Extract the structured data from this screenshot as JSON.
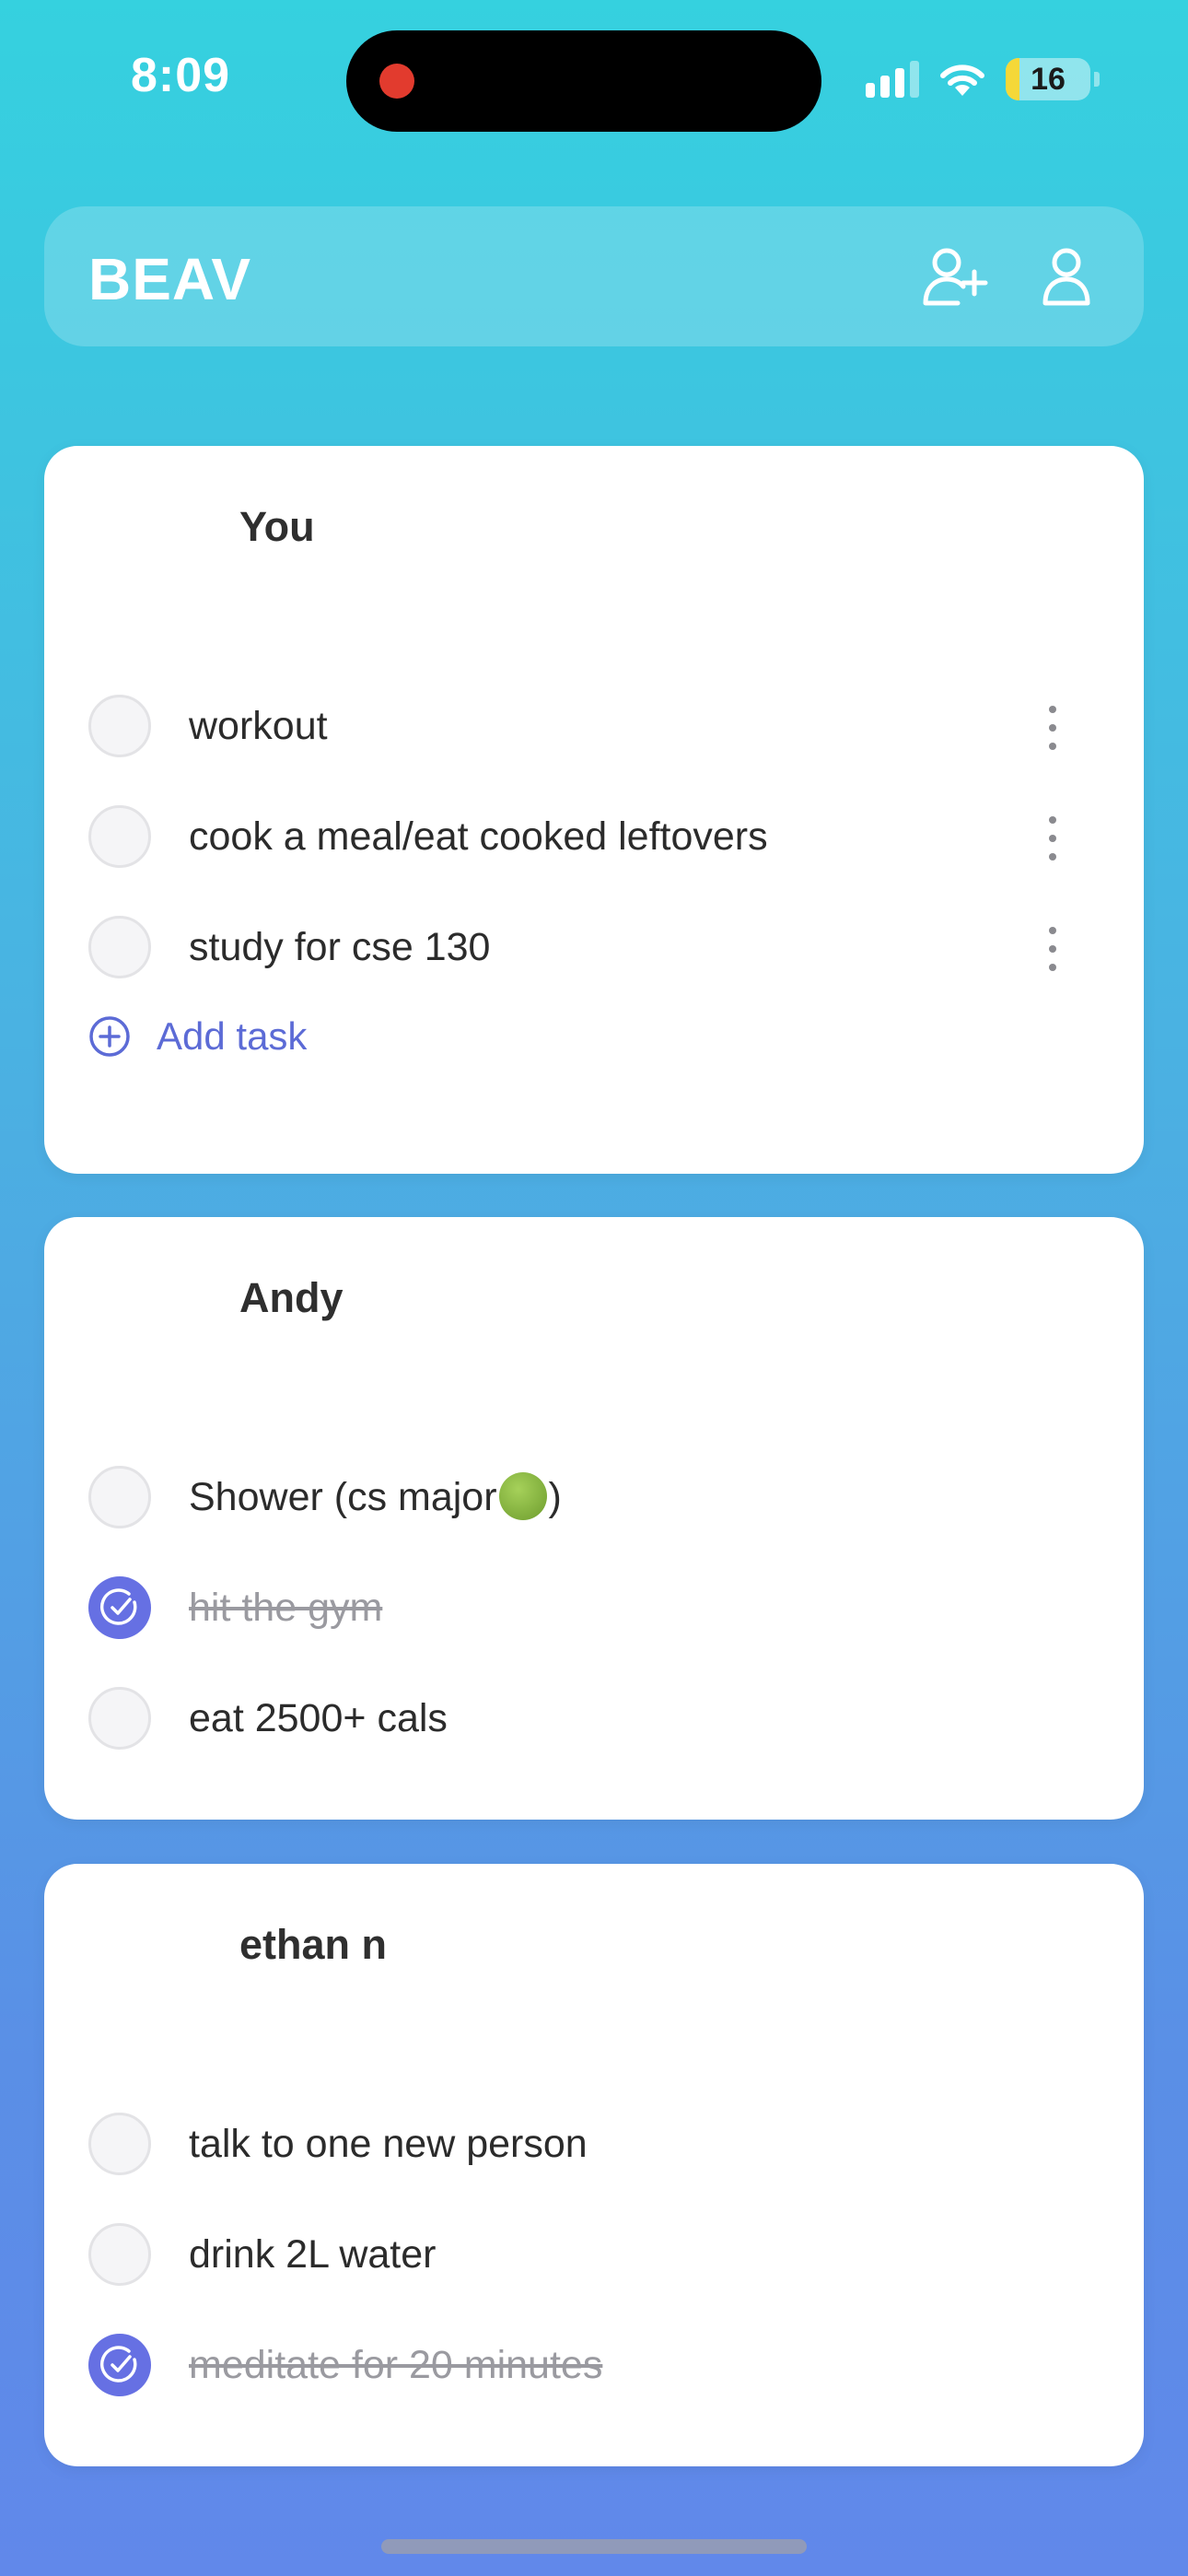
{
  "status_bar": {
    "time": "8:09",
    "battery_level": "16",
    "battery_fraction": 0.16,
    "signal_bars_active": 3
  },
  "header": {
    "brand": "BEAV",
    "add_friend_icon": "add-friend-icon",
    "profile_icon": "profile-icon"
  },
  "colors": {
    "accent": "#6670e3",
    "link": "#5c6bd6",
    "gradient_top": "#35d1df",
    "gradient_bottom": "#6188ea"
  },
  "cards": [
    {
      "name": "You",
      "tasks": [
        {
          "text": "workout",
          "done": false
        },
        {
          "text": "cook a meal/eat cooked leftovers",
          "done": false
        },
        {
          "text": "study for cse 130",
          "done": false
        }
      ],
      "add_task_label": "Add task"
    },
    {
      "name": "Andy",
      "tasks": [
        {
          "text": "Shower (cs major",
          "suffix": ")",
          "emoji": "nauseated-face",
          "done": false
        },
        {
          "text": "hit the gym",
          "done": true
        },
        {
          "text": "eat 2500+ cals",
          "done": false
        }
      ]
    },
    {
      "name": "ethan n",
      "tasks": [
        {
          "text": "talk to one new person",
          "done": false
        },
        {
          "text": "drink 2L water",
          "done": false
        },
        {
          "text": "meditate for 20 minutes",
          "done": true
        }
      ]
    }
  ]
}
